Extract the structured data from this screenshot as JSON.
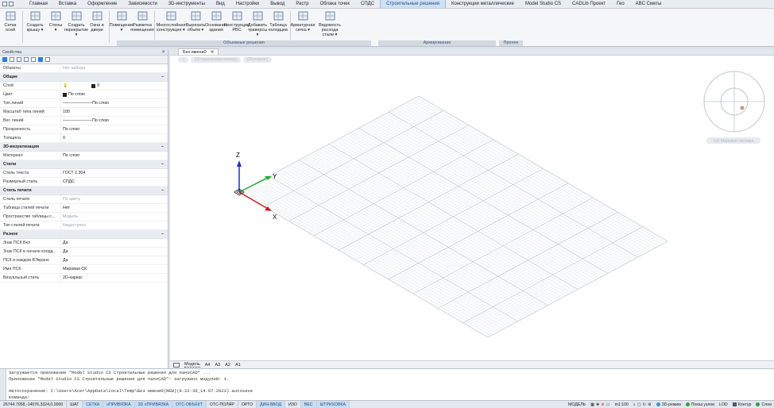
{
  "menu": {
    "items": [
      "Главная",
      "Вставка",
      "Оформление",
      "Зависимости",
      "3D-инструменты",
      "Вид",
      "Настройки",
      "Вывод",
      "Растр",
      "Облака точек",
      "СПДС",
      "Строительные решения",
      "Конструкции металлические",
      "Model Studio CS",
      "CADLib Проект",
      "Гео",
      "ABC Сметы"
    ],
    "active_index": 11
  },
  "ribbon": {
    "buttons": [
      {
        "label": "Сетка осей"
      },
      {
        "label": "Создать крышу ▾"
      },
      {
        "label": "Стены ▾"
      },
      {
        "label": "Создать перекрытие ▾"
      },
      {
        "label": "Окна и двери"
      },
      {
        "label": "Помещение ▾"
      },
      {
        "label": "Разметка помещения"
      },
      {
        "label": "Многослойная конструкция ▾"
      },
      {
        "label": "Вырезать объём ▾"
      },
      {
        "label": "Основания здания"
      },
      {
        "label": "Конструкции PBC"
      },
      {
        "label": "Добавить траверсы ▾"
      },
      {
        "label": "Таблица колодцев"
      },
      {
        "label": "Арматурная сетка ▾"
      },
      {
        "label": "Ведомость расхода стали ▾"
      }
    ],
    "groups": [
      "Объемные решения",
      "Армирование",
      "Прочее"
    ]
  },
  "properties": {
    "title": "Свойства",
    "rows": [
      {
        "type": "row",
        "k": "Объекты",
        "v": "Нет набора",
        "muted": true
      },
      {
        "type": "sec",
        "k": "Общие"
      },
      {
        "type": "row",
        "k": "Слой",
        "v": "0"
      },
      {
        "type": "row",
        "k": "Цвет",
        "v": "По слою"
      },
      {
        "type": "row",
        "k": "Тип линий",
        "v": "———————По слою"
      },
      {
        "type": "row",
        "k": "Масштаб типа линий",
        "v": "100"
      },
      {
        "type": "row",
        "k": "Вес линий",
        "v": "———————По слою"
      },
      {
        "type": "row",
        "k": "Прозрачность",
        "v": "По слою"
      },
      {
        "type": "row",
        "k": "Толщина",
        "v": "0"
      },
      {
        "type": "sec",
        "k": "3D-визуализация"
      },
      {
        "type": "row",
        "k": "Материал",
        "v": "По слою"
      },
      {
        "type": "sec",
        "k": "Стили"
      },
      {
        "type": "row",
        "k": "Стиль текста",
        "v": "ГОСТ 2.304"
      },
      {
        "type": "row",
        "k": "Размерный стиль",
        "v": "СПДС"
      },
      {
        "type": "sec",
        "k": "Стиль печати"
      },
      {
        "type": "row",
        "k": "Стиль печати",
        "v": "По цвету",
        "muted": true
      },
      {
        "type": "row",
        "k": "Таблица стилей печати",
        "v": "Нет"
      },
      {
        "type": "row",
        "k": "Пространство таблицы с...",
        "v": "Модель",
        "muted": true
      },
      {
        "type": "row",
        "k": "Тип стилей печати",
        "v": "Недоступно",
        "muted": true
      },
      {
        "type": "sec",
        "k": "Разное"
      },
      {
        "type": "row",
        "k": "Знак ПСК Вкл",
        "v": "Да"
      },
      {
        "type": "row",
        "k": "Знак ПСК в начале коорд...",
        "v": "Да"
      },
      {
        "type": "row",
        "k": "ПСК в каждом ВЭкране",
        "v": "Да"
      },
      {
        "type": "row",
        "k": "Имя ПСК",
        "v": "Мировая СК"
      },
      {
        "type": "row",
        "k": "Визуальный стиль",
        "v": "2D-каркас"
      }
    ]
  },
  "document": {
    "tab_title": "Без имени0",
    "view_controls": [
      "–",
      "[3D-каркас/вид сверху]",
      "[2D-каркас]"
    ],
    "compass_label": "СК: Мировая система",
    "axes": {
      "x": "X",
      "y": "Y",
      "z": "Z"
    },
    "layout_tabs": [
      "Модель",
      "A4",
      "A3",
      "A2",
      "A1"
    ],
    "active_layout": 0
  },
  "command": {
    "lines": [
      "Загружается приложение \"Model Studio CS Строительные решения для nanoCAD\" ...",
      "Приложение \"Model Studio CS Строительные решения для nanoCAD\": загружено модулей: 1.",
      "",
      "Автосохранение: C:\\Users\\Acer\\AppData\\Local\\Temp\\Без имени0(NEW)(8-22-36_14.07.2023).autosave",
      "Команда:"
    ]
  },
  "status": {
    "coords": "26744.7058,-14076.3324,0.0000",
    "toggles": [
      {
        "label": "ШАГ",
        "on": false
      },
      {
        "label": "СЕТКА",
        "on": true
      },
      {
        "label": "оПРИВЯЗКА",
        "on": true
      },
      {
        "label": "3D оПРИВЯЗКА",
        "on": true
      },
      {
        "label": "ОТС-ОБЪЕКТ",
        "on": true
      },
      {
        "label": "ОТС-ПОЛЯР",
        "on": false
      },
      {
        "label": "ОРТО",
        "on": false
      },
      {
        "label": "ДИН-ВВОД",
        "on": true
      },
      {
        "label": "ИЗО",
        "on": false
      },
      {
        "label": "ВЕС",
        "on": true
      },
      {
        "label": "ШТРИХОВКА",
        "on": true
      }
    ],
    "space": "МОДЕЛЬ",
    "scale": "m1:100",
    "mode_3d": "3D-режим",
    "show_nodes": "Показ узлов",
    "lod": "LOD",
    "contour": "Контур",
    "layers": "Слои"
  }
}
